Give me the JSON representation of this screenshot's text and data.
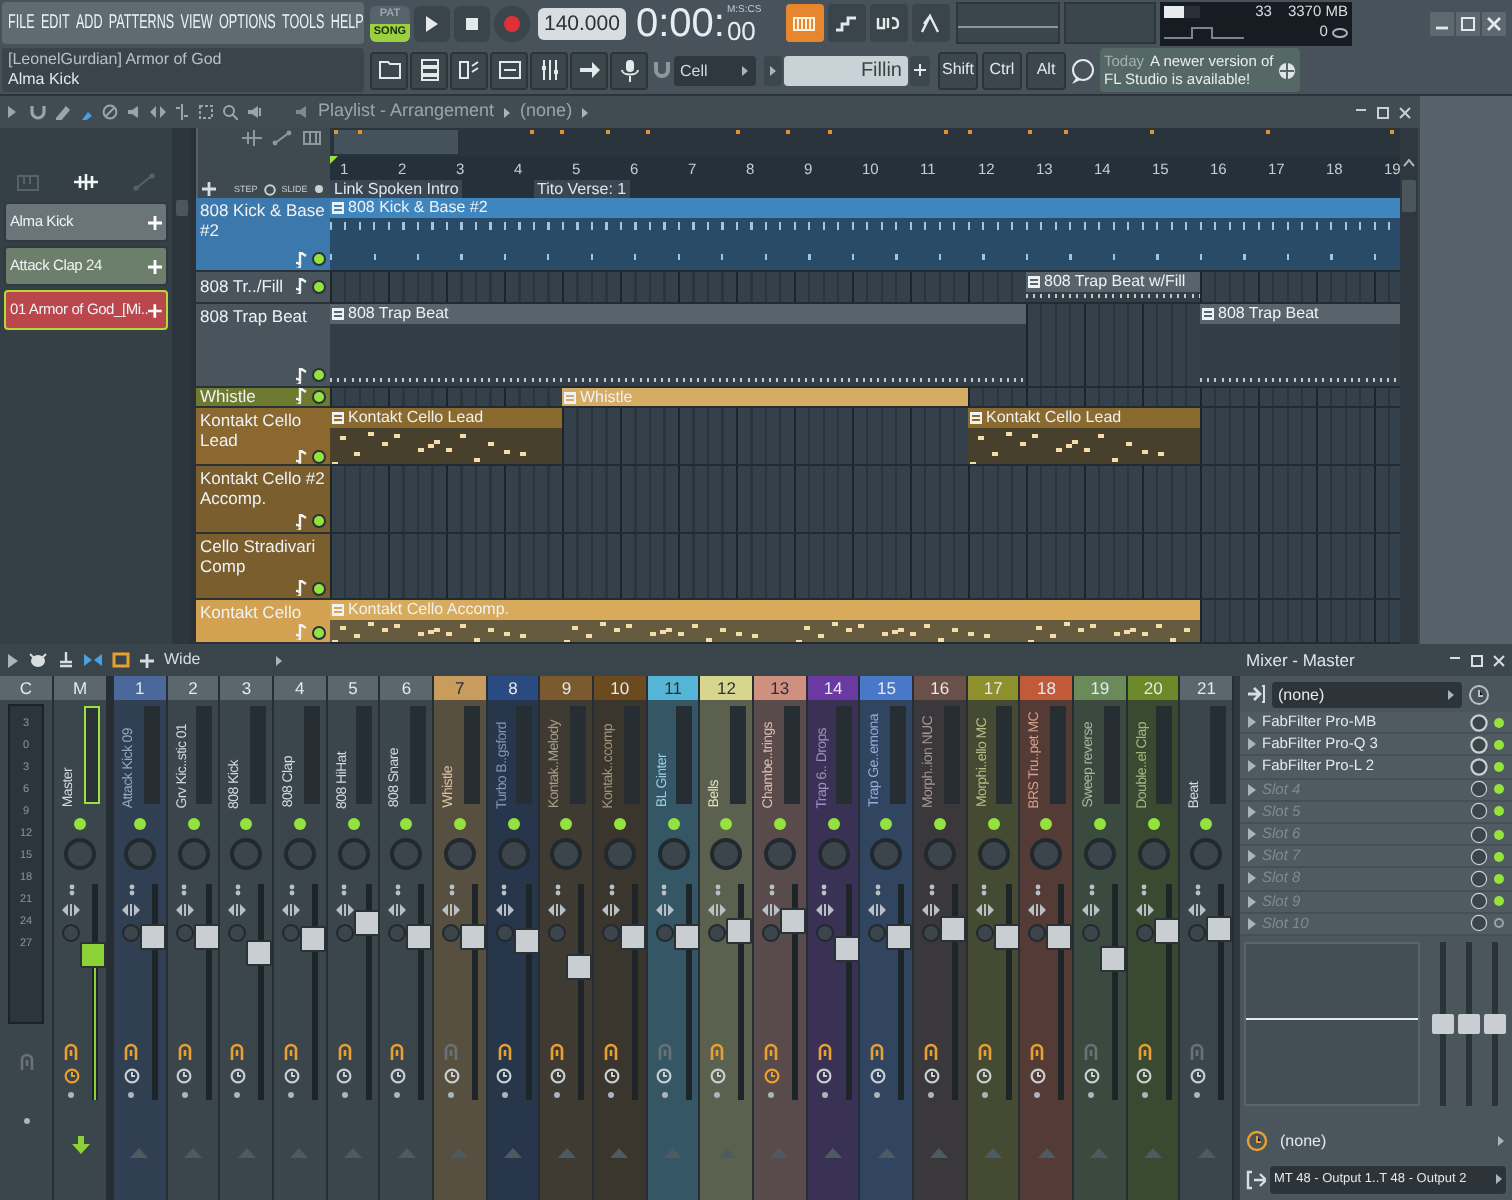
{
  "menu": [
    "FILE",
    "EDIT",
    "ADD",
    "PATTERNS",
    "VIEW",
    "OPTIONS",
    "TOOLS",
    "HELP"
  ],
  "transport": {
    "modes": [
      {
        "label": "PAT",
        "selected": false
      },
      {
        "label": "SONG",
        "selected": true
      }
    ],
    "tempo": "140.000",
    "time": "0:00:",
    "time_small": "00",
    "time_unit": "M:S:CS"
  },
  "toggles": [
    {
      "kind": "typing",
      "on": true
    },
    {
      "kind": "steps",
      "on": false
    },
    {
      "kind": "blend",
      "on": false
    },
    {
      "kind": "metronome",
      "on": false
    }
  ],
  "monitor": {
    "level": 0.55,
    "cpu": "33",
    "memory": "3370 MB",
    "polyphony": "0"
  },
  "hint_bar": {
    "title": "[LeonelGurdian] Armor of God",
    "item": "Alma Kick"
  },
  "snap": "Cell",
  "pattern": "Fillin",
  "modifiers": [
    "Shift",
    "Ctrl",
    "Alt"
  ],
  "news": {
    "label": "Today",
    "text": "A newer version of FL Studio is available!"
  },
  "playlist": {
    "title": "Playlist - Arrangement",
    "pattern": "(none)",
    "step": "STEP",
    "slide": "SLIDE",
    "picker_tabs": [
      {
        "kind": "piano",
        "selected": false
      },
      {
        "kind": "audio",
        "selected": true
      },
      {
        "kind": "automation",
        "selected": false
      }
    ],
    "picker": [
      {
        "label": "Alma Kick",
        "color": "#6b7479",
        "selected": false
      },
      {
        "label": "Attack Clap 24",
        "color": "#6b7f6b",
        "selected": false
      },
      {
        "label": "01 Armor of God_[Mi..",
        "color": "#b9474c",
        "selected": true
      }
    ],
    "ruler": [
      "1",
      "2",
      "3",
      "4",
      "5",
      "6",
      "7",
      "8",
      "9",
      "10",
      "11",
      "12",
      "13",
      "14",
      "15",
      "16",
      "17",
      "18",
      "19"
    ],
    "markers": [
      {
        "label": "Link Spoken Intro"
      },
      {
        "label": "Tito Verse: 1"
      }
    ],
    "tracks": [
      {
        "name": "808 Kick & Base #2",
        "color": "#3d78ac",
        "enabled": true,
        "clips": [
          {
            "label": "808 Kick & Base #2",
            "color": "#3f86bf",
            "kind": "drums"
          }
        ]
      },
      {
        "name": "808 Tr../Fill",
        "color": "#4a545c",
        "enabled": true,
        "clips": [
          {
            "label": "808 Trap Beat w/Fill",
            "color": "#59636b",
            "kind": "beat"
          }
        ]
      },
      {
        "name": "808 Trap Beat",
        "color": "#4a545c",
        "enabled": true,
        "clips": [
          {
            "label": "808 Trap Beat",
            "color": "#59636b",
            "kind": "beat"
          },
          {
            "label": "808 Trap Beat",
            "color": "#59636b",
            "kind": "beat"
          }
        ]
      },
      {
        "name": "Whistle",
        "color": "#6d7a30",
        "enabled": true,
        "clips": [
          {
            "label": "Whistle",
            "color": "#d4ac64",
            "kind": "audio"
          }
        ]
      },
      {
        "name": "Kontakt Cello Lead",
        "color": "#8a6830",
        "enabled": true,
        "clips": [
          {
            "label": "Kontakt Cello Lead",
            "color": "#8a6a2e",
            "kind": "melody"
          },
          {
            "label": "Kontakt Cello Lead",
            "color": "#8a6a2e",
            "kind": "melody"
          }
        ]
      },
      {
        "name": "Kontakt Cello #2 Accomp.",
        "color": "#7a5e2e",
        "enabled": true
      },
      {
        "name": "Cello Stradivari Comp",
        "color": "#7a5e2e",
        "enabled": true
      },
      {
        "name": "Kontakt Cello",
        "color": "#d2a252",
        "enabled": true,
        "clips": [
          {
            "label": "Kontakt Cello Accomp.",
            "color": "#d8aa5c",
            "kind": "melody"
          }
        ]
      }
    ]
  },
  "mixer": {
    "mode": "Wide",
    "strips": [
      {
        "kind": "current",
        "number": "C",
        "color": "#5b666d",
        "scale": [
          "3",
          "0",
          "3",
          "6",
          "9",
          "12",
          "15",
          "18",
          "21",
          "24",
          "27"
        ],
        "routed": false
      },
      {
        "kind": "master",
        "number": "M",
        "name": "Master",
        "color": "#5b666d",
        "level": 0.7,
        "routed": true,
        "timer": true
      },
      {
        "kind": "insert",
        "number": "1",
        "name": "Attack Kick 09",
        "color": "#4a6899",
        "level": 0.79,
        "routed": true,
        "timer": false
      },
      {
        "kind": "insert",
        "number": "2",
        "name": "Grv Kic..stic 01",
        "color": "#5b666d",
        "level": 0.79,
        "routed": true,
        "timer": false
      },
      {
        "kind": "insert",
        "number": "3",
        "name": "808 Kick",
        "color": "#5b666d",
        "level": 0.71,
        "routed": true,
        "timer": false
      },
      {
        "kind": "insert",
        "number": "4",
        "name": "808 Clap",
        "color": "#5b666d",
        "level": 0.78,
        "routed": true,
        "timer": false
      },
      {
        "kind": "insert",
        "number": "5",
        "name": "808 HiHat",
        "color": "#5b666d",
        "level": 0.86,
        "routed": true,
        "timer": false
      },
      {
        "kind": "insert",
        "number": "6",
        "name": "808 Snare",
        "color": "#5b666d",
        "level": 0.79,
        "routed": true,
        "timer": false
      },
      {
        "kind": "insert",
        "number": "7",
        "name": "Whistle",
        "color": "#c89c5c",
        "level": 0.79,
        "routed": false,
        "timer": false
      },
      {
        "kind": "insert",
        "number": "8",
        "name": "Turbo B..gsford",
        "color": "#2a4a82",
        "level": 0.77,
        "routed": true,
        "timer": false
      },
      {
        "kind": "insert",
        "number": "9",
        "name": "Kontak..Melody",
        "color": "#7a5a2e",
        "level": 0.63,
        "routed": true,
        "timer": false
      },
      {
        "kind": "insert",
        "number": "10",
        "name": "Kontak..ccomp",
        "color": "#6a4a1e",
        "level": 0.79,
        "routed": true,
        "timer": false
      },
      {
        "kind": "insert",
        "number": "11",
        "name": "BL Ginter",
        "color": "#56b4d6",
        "level": 0.79,
        "routed": false,
        "timer": false
      },
      {
        "kind": "insert",
        "number": "12",
        "name": "Bells",
        "color": "#d6d68e",
        "level": 0.82,
        "routed": true,
        "timer": false
      },
      {
        "kind": "insert",
        "number": "13",
        "name": "Chambe..trings",
        "color": "#d09080",
        "level": 0.87,
        "routed": true,
        "timer": true
      },
      {
        "kind": "insert",
        "number": "14",
        "name": "Trap 6.. Drops",
        "color": "#6a3aa2",
        "level": 0.73,
        "routed": true,
        "timer": false
      },
      {
        "kind": "insert",
        "number": "15",
        "name": "Trap Ge..emona",
        "color": "#4a78c8",
        "level": 0.79,
        "routed": true,
        "timer": false
      },
      {
        "kind": "insert",
        "number": "16",
        "name": "Morph..ion NUC",
        "color": "#6a5048",
        "level": 0.83,
        "routed": true,
        "timer": false
      },
      {
        "kind": "insert",
        "number": "17",
        "name": "Morphi..ello MC",
        "color": "#8e902e",
        "level": 0.79,
        "routed": true,
        "timer": false
      },
      {
        "kind": "insert",
        "number": "18",
        "name": "BRS Tru..pet MC",
        "color": "#c05a38",
        "level": 0.79,
        "routed": true,
        "timer": false
      },
      {
        "kind": "insert",
        "number": "19",
        "name": "Sweep reverse",
        "color": "#6a8a5a",
        "level": 0.67,
        "routed": false,
        "timer": false
      },
      {
        "kind": "insert",
        "number": "20",
        "name": "Double..el Clap",
        "color": "#6a8a2a",
        "level": 0.82,
        "routed": true,
        "timer": false
      },
      {
        "kind": "insert",
        "number": "21",
        "name": "Beat",
        "color": "#5b666d",
        "level": 0.83,
        "routed": false,
        "timer": false
      }
    ]
  },
  "mixer_panel": {
    "title": "Mixer - Master",
    "input": "(none)",
    "slots": [
      {
        "name": "FabFilter Pro-MB",
        "empty": false,
        "enabled": true
      },
      {
        "name": "FabFilter Pro-Q 3",
        "empty": false,
        "enabled": true
      },
      {
        "name": "FabFilter Pro-L 2",
        "empty": false,
        "enabled": true
      },
      {
        "name": "Slot 4",
        "empty": true,
        "enabled": true
      },
      {
        "name": "Slot 5",
        "empty": true,
        "enabled": true
      },
      {
        "name": "Slot 6",
        "empty": true,
        "enabled": true
      },
      {
        "name": "Slot 7",
        "empty": true,
        "enabled": true
      },
      {
        "name": "Slot 8",
        "empty": true,
        "enabled": true
      },
      {
        "name": "Slot 9",
        "empty": true,
        "enabled": true
      },
      {
        "name": "Slot 10",
        "empty": true,
        "enabled": false
      }
    ],
    "faders": [
      {
        "level": 0.5
      },
      {
        "level": 0.5
      },
      {
        "level": 0.5
      }
    ],
    "sidechain": "(none)",
    "output": "MT 48 - Output 1..T 48 - Output 2"
  }
}
